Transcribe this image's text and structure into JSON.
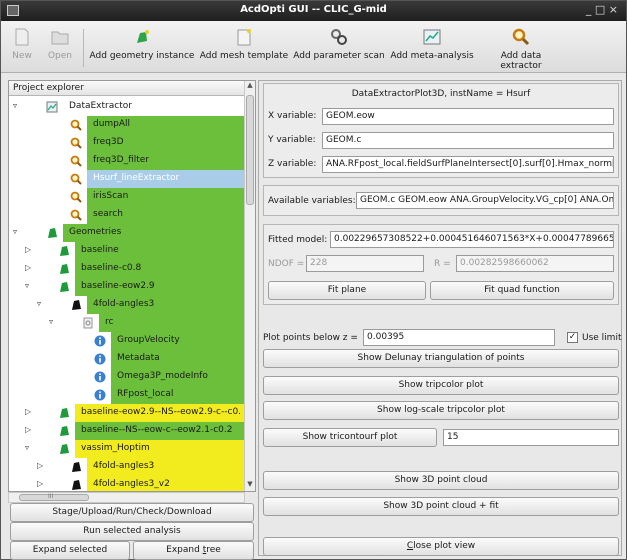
{
  "window": {
    "title": "AcdOpti GUI -- CLIC_G-mid",
    "controls": "_ □ ×"
  },
  "toolbar": {
    "new": "New",
    "open": "Open",
    "add_geometry": "Add geometry instance",
    "add_mesh": "Add mesh template",
    "add_param_scan": "Add parameter scan",
    "add_meta": "Add meta-analysis",
    "add_extractor": "Add data extractor"
  },
  "explorer": {
    "header": "Project explorer",
    "scroll_mark": "III",
    "rows": [
      {
        "label": "DataExtractor",
        "indent": 0,
        "arrow": "▿",
        "icon": "extractor",
        "hl": ""
      },
      {
        "label": "dumpAll",
        "indent": 2,
        "arrow": "",
        "icon": "magnifier",
        "hl": "green"
      },
      {
        "label": "freq3D",
        "indent": 2,
        "arrow": "",
        "icon": "magnifier",
        "hl": "green"
      },
      {
        "label": "freq3D_filter",
        "indent": 2,
        "arrow": "",
        "icon": "magnifier",
        "hl": "green"
      },
      {
        "label": "Hsurf_lineExtractor",
        "indent": 2,
        "arrow": "",
        "icon": "magnifier",
        "hl": "sel"
      },
      {
        "label": "irisScan",
        "indent": 2,
        "arrow": "",
        "icon": "magnifier",
        "hl": "green"
      },
      {
        "label": "search",
        "indent": 2,
        "arrow": "",
        "icon": "magnifier",
        "hl": "green"
      },
      {
        "label": "Geometries",
        "indent": 0,
        "arrow": "▿",
        "icon": "geom",
        "hl": "green"
      },
      {
        "label": "baseline",
        "indent": 1,
        "arrow": "▷",
        "icon": "geom",
        "hl": "green"
      },
      {
        "label": "baseline-c0.8",
        "indent": 1,
        "arrow": "▷",
        "icon": "geom",
        "hl": "green"
      },
      {
        "label": "baseline-eow2.9",
        "indent": 1,
        "arrow": "▿",
        "icon": "geom",
        "hl": "green"
      },
      {
        "label": "4fold-angles3",
        "indent": 2,
        "arrow": "▿",
        "icon": "mesh",
        "hl": "green"
      },
      {
        "label": "rc",
        "indent": 3,
        "arrow": "▿",
        "icon": "rc",
        "hl": "green"
      },
      {
        "label": "GroupVelocity",
        "indent": 4,
        "arrow": "",
        "icon": "info",
        "hl": "green"
      },
      {
        "label": "Metadata",
        "indent": 4,
        "arrow": "",
        "icon": "info",
        "hl": "green"
      },
      {
        "label": "Omega3P_modeInfo",
        "indent": 4,
        "arrow": "",
        "icon": "info",
        "hl": "green"
      },
      {
        "label": "RFpost_local",
        "indent": 4,
        "arrow": "",
        "icon": "info",
        "hl": "green"
      },
      {
        "label": "baseline-eow2.9--NS--eow2.9-c--c0.",
        "indent": 1,
        "arrow": "▷",
        "icon": "geom",
        "hl": "yellow"
      },
      {
        "label": "baseline--NS--eow-c--eow2.1-c0.2",
        "indent": 1,
        "arrow": "▷",
        "icon": "geom",
        "hl": "green"
      },
      {
        "label": "vassim_Hoptim",
        "indent": 1,
        "arrow": "▿",
        "icon": "geom",
        "hl": "yellow"
      },
      {
        "label": "4fold-angles3",
        "indent": 2,
        "arrow": "▷",
        "icon": "mesh",
        "hl": "yellow"
      },
      {
        "label": "4fold-angles3_v2",
        "indent": 2,
        "arrow": "▷",
        "icon": "mesh",
        "hl": "yellow"
      },
      {
        "label": "4fold-angles3_v3",
        "indent": 2,
        "arrow": "▷",
        "icon": "mesh",
        "hl": "yellow"
      },
      {
        "label": "Vassim_Hoptim2",
        "indent": 1,
        "arrow": "▷",
        "icon": "geom",
        "hl": "green"
      }
    ],
    "btn_stage": "Stage/Upload/Run/Check/Download",
    "btn_run": "Run selected analysis",
    "btn_expand_selected": "Expand selected",
    "btn_expand_tree": "Expand tree"
  },
  "panel": {
    "header": "DataExtractorPlot3D, instName = Hsurf",
    "x_label": "X variable:",
    "x_value": "GEOM.eow",
    "y_label": "Y variable:",
    "y_value": "GEOM.c",
    "z_label": "Z variable:",
    "z_value": "ANA.RFpost_local.fieldSurfPlaneIntersect[0].surf[0].Hmax_norm[0]",
    "avail_label": "Available variables:",
    "avail_value": "GEOM.c GEOM.eow ANA.GroupVelocity.VG_cp[0] ANA.Omega",
    "fitted_label": "Fitted model:",
    "fitted_value": "0.00229657308522+0.000451646071563*X+0.000477896656508*",
    "ndof_label": "NDOF =",
    "ndof_value": "228",
    "r_label": "R =",
    "r_value": "0.00282598660062",
    "btn_fit_plane": "Fit plane",
    "btn_fit_quad": "Fit quad function",
    "plot_below_label": "Plot points below z =",
    "plot_below_value": "0.00395",
    "use_limit": "Use limit",
    "btn_delaunay": "Show Delunay triangulation of points",
    "btn_tripcolor": "Show tripcolor plot",
    "btn_logtripcolor": "Show log-scale tripcolor plot",
    "btn_tricontourf": "Show tricontourf plot",
    "tricontourf_value": "15",
    "btn_3d": "Show 3D point cloud",
    "btn_3dfit": "Show 3D point cloud + fit",
    "btn_close": "Close plot view"
  },
  "colors": {
    "green": "#6cbf3a",
    "yellow": "#f2ec1e",
    "selected": "#a9cde9"
  }
}
